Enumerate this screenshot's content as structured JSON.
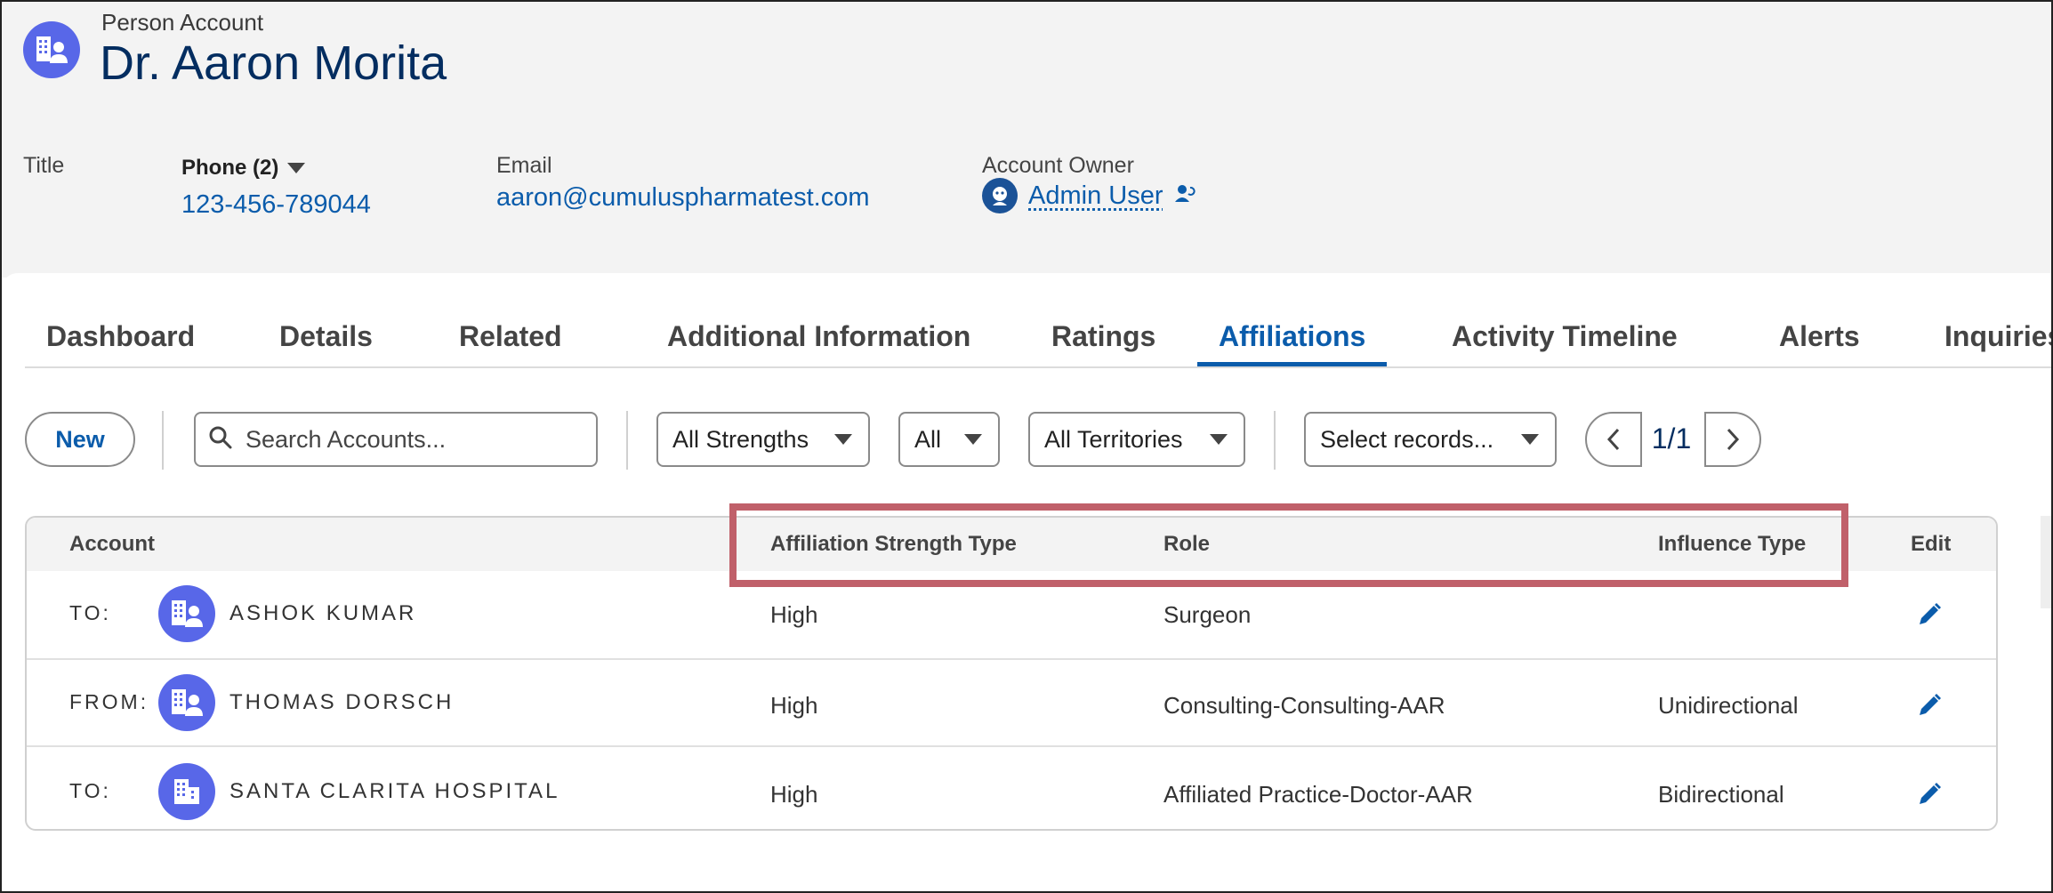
{
  "record": {
    "type": "Person Account",
    "name": "Dr. Aaron Morita"
  },
  "fields": {
    "title_label": "Title",
    "phone_label": "Phone (2)",
    "phone_value": "123-456-789044",
    "email_label": "Email",
    "email_value": "aaron@cumuluspharmatest.com",
    "owner_label": "Account Owner",
    "owner_value": "Admin User"
  },
  "tabs": [
    {
      "label": "Dashboard",
      "active": false
    },
    {
      "label": "Details",
      "active": false
    },
    {
      "label": "Related",
      "active": false
    },
    {
      "label": "Additional Information",
      "active": false
    },
    {
      "label": "Ratings",
      "active": false
    },
    {
      "label": "Affiliations",
      "active": true
    },
    {
      "label": "Activity Timeline",
      "active": false
    },
    {
      "label": "Alerts",
      "active": false
    },
    {
      "label": "Inquiries",
      "active": false
    }
  ],
  "toolbar": {
    "new_label": "New",
    "search_placeholder": "Search Accounts...",
    "strength_filter": "All Strengths",
    "all_filter": "All",
    "territory_filter": "All Territories",
    "records_select": "Select records...",
    "page_indicator": "1/1"
  },
  "table": {
    "headers": {
      "account": "Account",
      "strength": "Affiliation Strength Type",
      "role": "Role",
      "influence": "Influence Type",
      "edit": "Edit"
    },
    "rows": [
      {
        "direction": "TO:",
        "name": "ASHOK KUMAR",
        "icon": "person-account-icon",
        "strength": "High",
        "role": "Surgeon",
        "influence": ""
      },
      {
        "direction": "FROM:",
        "name": "THOMAS DORSCH",
        "icon": "person-account-icon",
        "strength": "High",
        "role": "Consulting-Consulting-AAR",
        "influence": "Unidirectional"
      },
      {
        "direction": "TO:",
        "name": "SANTA CLARITA HOSPITAL",
        "icon": "business-account-icon",
        "strength": "High",
        "role": "Affiliated Practice-Doctor-AAR",
        "influence": "Bidirectional"
      }
    ]
  },
  "colors": {
    "brand": "#0b5cab",
    "icon_bg": "#5867e8",
    "highlight": "#c0606a"
  }
}
